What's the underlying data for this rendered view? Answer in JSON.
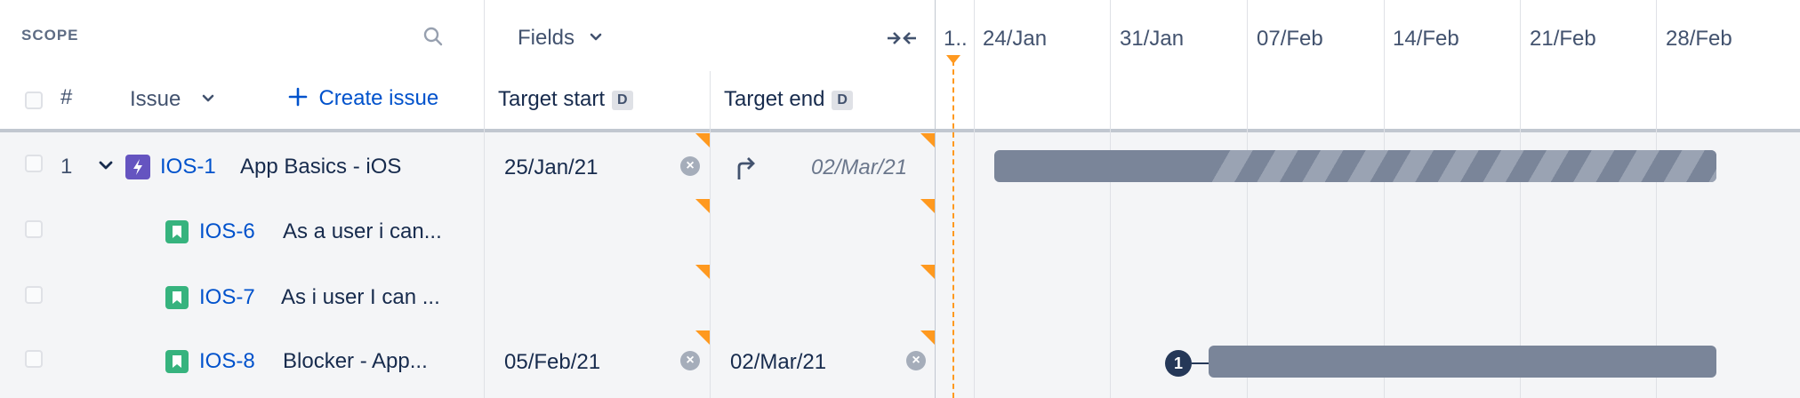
{
  "scope": {
    "title": "SCOPE",
    "hash_label": "#",
    "issue_label": "Issue",
    "create_issue_label": "Create issue"
  },
  "fields": {
    "label": "Fields",
    "target_start_label": "Target start",
    "target_end_label": "Target end",
    "date_badge": "D"
  },
  "timeline": {
    "today_marker": "1..",
    "weeks": [
      "24/Jan",
      "31/Jan",
      "07/Feb",
      "14/Feb",
      "21/Feb",
      "28/Feb"
    ]
  },
  "rows": [
    {
      "num": "1",
      "key": "IOS-1",
      "summary": "App Basics - iOS",
      "type": "epic",
      "start": "25/Jan/21",
      "end": "02/Mar/21",
      "end_inferred": true
    },
    {
      "num": "",
      "key": "IOS-6",
      "summary": "As a user i can...",
      "type": "story",
      "start": "",
      "end": "",
      "end_inferred": false
    },
    {
      "num": "",
      "key": "IOS-7",
      "summary": "As i user I can ...",
      "type": "story",
      "start": "",
      "end": "",
      "end_inferred": false
    },
    {
      "num": "",
      "key": "IOS-8",
      "summary": "Blocker - App...",
      "type": "story",
      "start": "05/Feb/21",
      "end": "02/Mar/21",
      "end_inferred": false,
      "dependency_count": "1"
    }
  ],
  "colors": {
    "accent": "#0052cc",
    "epic": "#6554c0",
    "story": "#36b37e",
    "bar": "#7a8599",
    "warning": "#ff991f"
  }
}
